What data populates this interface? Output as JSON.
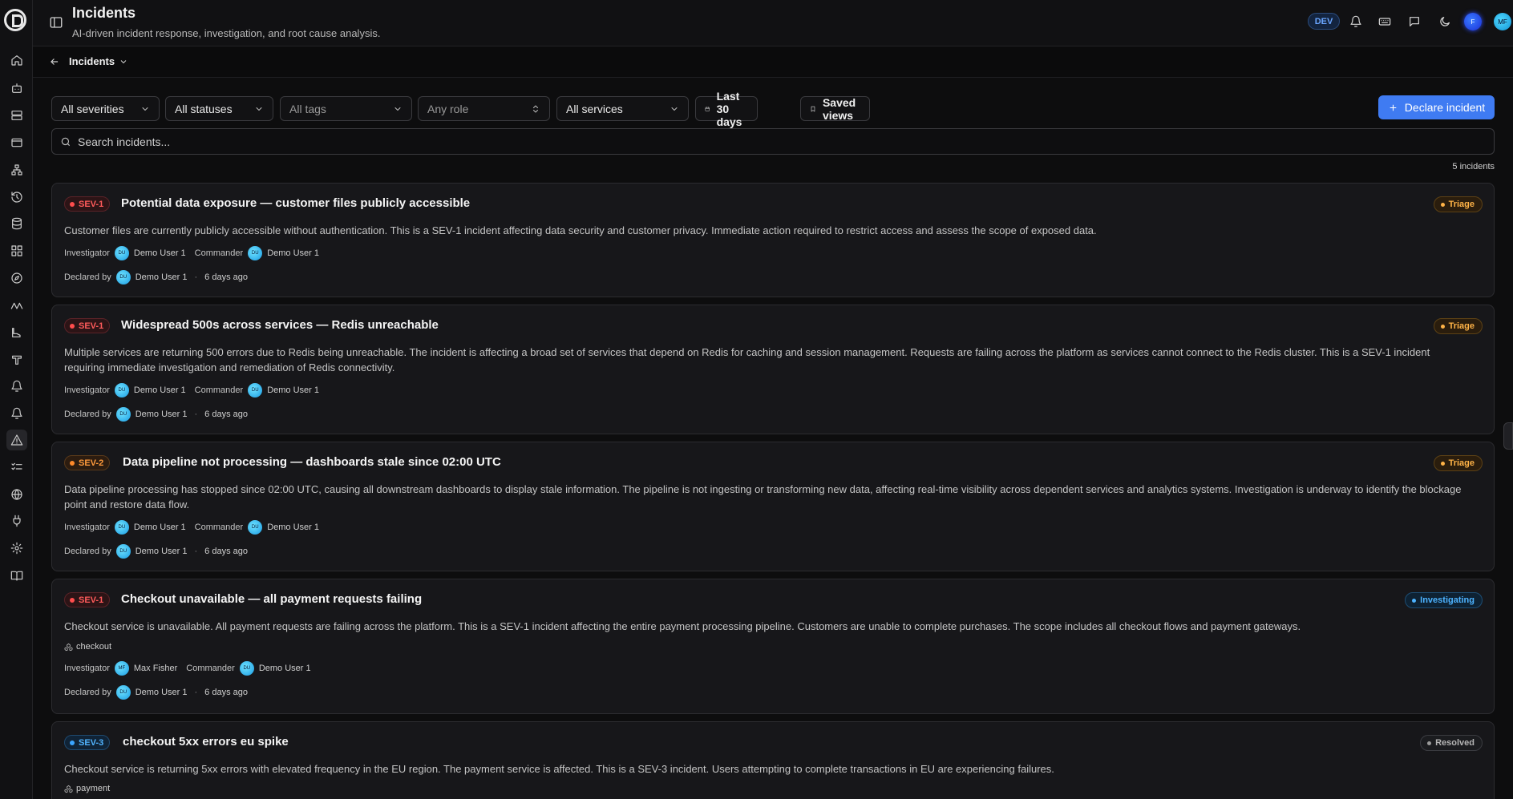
{
  "header": {
    "title": "Incidents",
    "subtitle": "AI-driven incident response, investigation, and root cause analysis.",
    "env_badge": "DEV",
    "avatar_initials_1": "F",
    "avatar_initials_2": "MF"
  },
  "breadcrumb": {
    "label": "Incidents"
  },
  "filters": {
    "severity": "All severities",
    "status": "All statuses",
    "tags_placeholder": "All tags",
    "role_placeholder": "Any role",
    "services": "All services",
    "date_range": "Last 30 days",
    "saved_views": "Saved views"
  },
  "declare_button": "Declare incident",
  "search": {
    "placeholder": "Search incidents..."
  },
  "incident_count": "5 incidents",
  "labels": {
    "investigator": "Investigator",
    "commander": "Commander",
    "declared_by": "Declared by",
    "dot": "·"
  },
  "incidents": [
    {
      "severity": "SEV-1",
      "title": "Potential data exposure — customer files publicly accessible",
      "status": "Triage",
      "description": "Customer files are currently publicly accessible without authentication. This is a SEV-1 incident affecting data security and customer privacy. Immediate action required to restrict access and assess the scope of exposed data.",
      "investigator": "Demo User 1",
      "investigator_initials": "DU",
      "commander": "Demo User 1",
      "commander_initials": "DU",
      "declared_by": "Demo User 1",
      "declared_initials": "DU",
      "declared_ago": "6 days ago"
    },
    {
      "severity": "SEV-1",
      "title": "Widespread 500s across services — Redis unreachable",
      "status": "Triage",
      "description": "Multiple services are returning 500 errors due to Redis being unreachable. The incident is affecting a broad set of services that depend on Redis for caching and session management. Requests are failing across the platform as services cannot connect to the Redis cluster. This is a SEV-1 incident requiring immediate investigation and remediation of Redis connectivity.",
      "investigator": "Demo User 1",
      "investigator_initials": "DU",
      "commander": "Demo User 1",
      "commander_initials": "DU",
      "declared_by": "Demo User 1",
      "declared_initials": "DU",
      "declared_ago": "6 days ago"
    },
    {
      "severity": "SEV-2",
      "title": "Data pipeline not processing — dashboards stale since 02:00 UTC",
      "status": "Triage",
      "description": "Data pipeline processing has stopped since 02:00 UTC, causing all downstream dashboards to display stale information. The pipeline is not ingesting or transforming new data, affecting real-time visibility across dependent services and analytics systems. Investigation is underway to identify the blockage point and restore data flow.",
      "investigator": "Demo User 1",
      "investigator_initials": "DU",
      "commander": "Demo User 1",
      "commander_initials": "DU",
      "declared_by": "Demo User 1",
      "declared_initials": "DU",
      "declared_ago": "6 days ago"
    },
    {
      "severity": "SEV-1",
      "title": "Checkout unavailable — all payment requests failing",
      "status": "Investigating",
      "description": "Checkout service is unavailable. All payment requests are failing across the platform. This is a SEV-1 incident affecting the entire payment processing pipeline. Customers are unable to complete purchases. The scope includes all checkout flows and payment gateways.",
      "service_tag": "checkout",
      "investigator": "Max Fisher",
      "investigator_initials": "MF",
      "commander": "Demo User 1",
      "commander_initials": "DU",
      "declared_by": "Demo User 1",
      "declared_initials": "DU",
      "declared_ago": "6 days ago"
    },
    {
      "severity": "SEV-3",
      "title": "checkout 5xx errors eu spike",
      "status": "Resolved",
      "description": "Checkout service is returning 5xx errors with elevated frequency in the EU region. The payment service is affected. This is a SEV-3 incident. Users attempting to complete transactions in EU are experiencing failures.",
      "service_tag": "payment"
    }
  ]
}
